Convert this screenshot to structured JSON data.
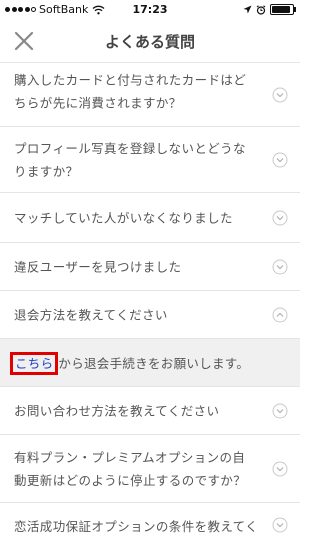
{
  "status_bar": {
    "carrier": "SoftBank",
    "time": "17:23",
    "signal_bars": 4,
    "battery_level": 0.95
  },
  "header": {
    "title": "よくある質問",
    "close_icon": "close-icon"
  },
  "faq": {
    "items": [
      {
        "question": "購入したカードと付与されたカードはどちらが先に消費されますか？",
        "expanded": false
      },
      {
        "question": "プロフィール写真を登録しないとどうなりますか？",
        "expanded": false
      },
      {
        "question": "マッチしていた人がいなくなりました",
        "expanded": false
      },
      {
        "question": "違反ユーザーを見つけました",
        "expanded": false
      },
      {
        "question": "退会方法を教えてください",
        "expanded": true
      },
      {
        "question": "お問い合わせ方法を教えてください",
        "expanded": false
      },
      {
        "question": "有料プラン・プレミアムオプションの自動更新はどのように停止するのですか？",
        "expanded": false
      },
      {
        "question": "恋活成功保証オプションの条件を教えてく",
        "expanded": false
      }
    ],
    "answer": {
      "link_text": "こちら",
      "text": "から退会手続きをお願いします。"
    }
  },
  "colors": {
    "link": "#1a3dcc",
    "highlight_box": "#e00000",
    "answer_background": "#f0f0f0",
    "text": "#555555"
  }
}
